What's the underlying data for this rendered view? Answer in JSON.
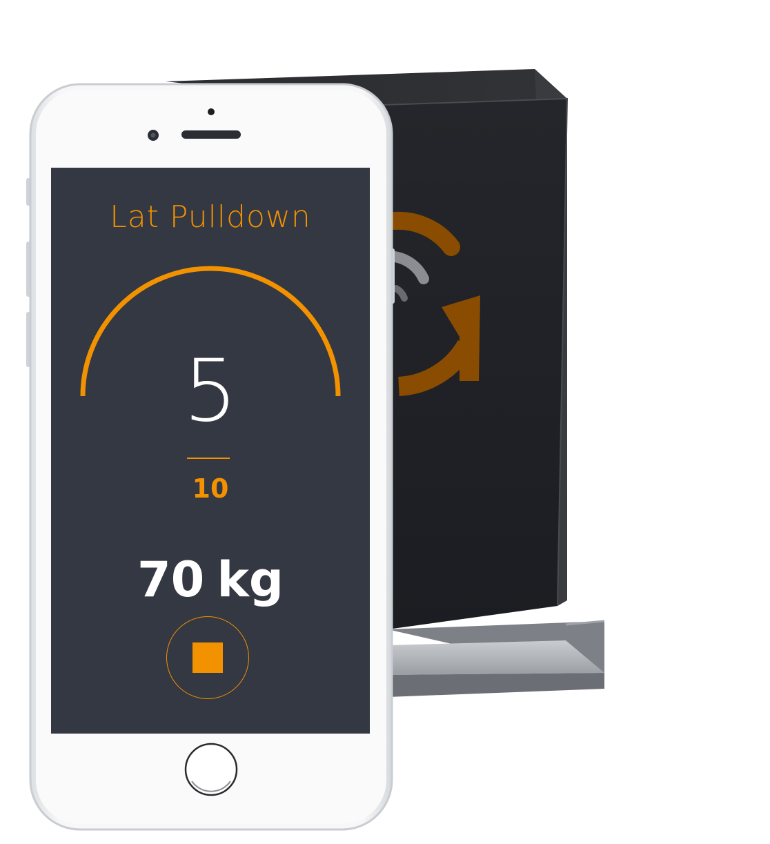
{
  "workout": {
    "exercise_name": "Lat Pulldown",
    "current_reps": "5",
    "target_reps": "10",
    "weight_value": "70",
    "weight_unit": "kg",
    "progress_fraction": 0.5
  },
  "controls": {
    "stop_icon": "stop-icon"
  },
  "colors": {
    "accent": "#f39200",
    "screen_background": "#343842",
    "text_primary": "#ffffff",
    "device_box": "#1f2127",
    "device_logo": "#8a4c00"
  }
}
